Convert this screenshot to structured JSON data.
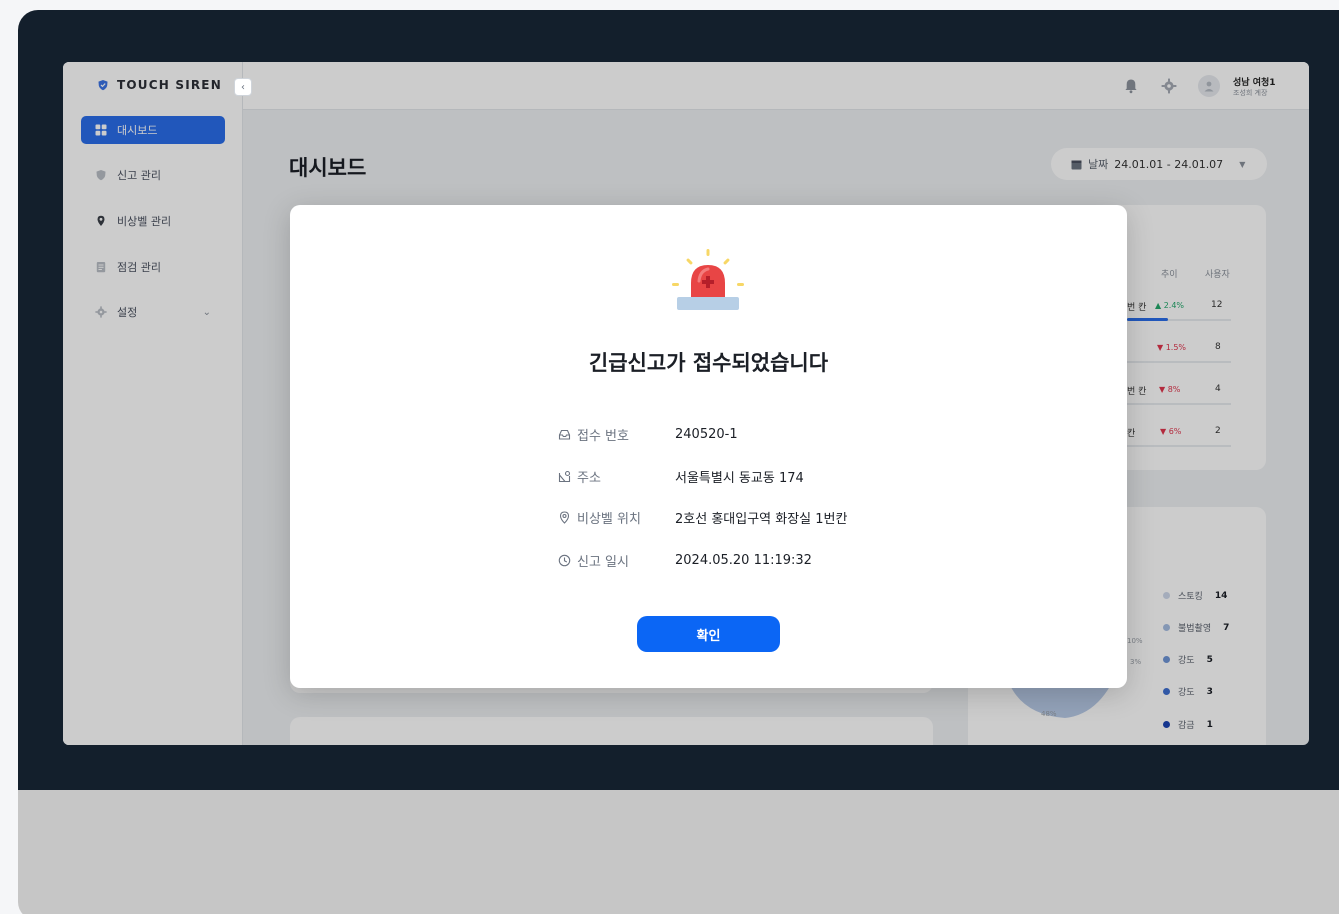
{
  "sidebar": {
    "logo_text": "TOUCH SIREN",
    "items": [
      {
        "label": "대시보드",
        "icon": "dashboard-icon",
        "active": true
      },
      {
        "label": "신고 관리",
        "icon": "shield-icon"
      },
      {
        "label": "비상벨 관리",
        "icon": "location-pin-icon"
      },
      {
        "label": "점검 관리",
        "icon": "clipboard-icon"
      },
      {
        "label": "설정",
        "icon": "gear-icon"
      }
    ]
  },
  "header": {
    "user_name": "성남 여청1",
    "user_role": "조성희 계장"
  },
  "main": {
    "page_title": "대시보드",
    "date_filter": {
      "label": "날짜",
      "value": "24.01.01 - 24.01.07"
    }
  },
  "table": {
    "headers": [
      "추이",
      "사용자"
    ],
    "rows": [
      {
        "location": "번 칸",
        "trend": "▲ 2.4%",
        "users": "12"
      },
      {
        "location": "",
        "trend": "▼ 1.5%",
        "users": "8"
      },
      {
        "location": "번 칸",
        "trend": "▼ 8%",
        "users": "4"
      },
      {
        "location": "칸",
        "trend": "▼ 6%",
        "users": "2"
      }
    ]
  },
  "pie": {
    "labels": [
      "10%",
      "3%",
      "48%"
    ],
    "legend": [
      {
        "label": "스토킹",
        "value": "14",
        "color": "#cdd8ea"
      },
      {
        "label": "불법촬영",
        "value": "7",
        "color": "#a6bde2"
      },
      {
        "label": "강도",
        "value": "5",
        "color": "#6f95d6"
      },
      {
        "label": "강도",
        "value": "3",
        "color": "#3e6fd0"
      },
      {
        "label": "감금",
        "value": "1",
        "color": "#1b44b3"
      }
    ]
  },
  "modal": {
    "title": "긴급신고가 접수되었습니다",
    "rows": [
      {
        "label": "접수 번호",
        "value": "240520-1",
        "icon": "inbox-icon"
      },
      {
        "label": "주소",
        "value": "서울특별시 동교동 174",
        "icon": "map-icon"
      },
      {
        "label": "비상벨 위치",
        "value": "2호선 홍대입구역 화장실 1번칸",
        "icon": "location-pin-icon"
      },
      {
        "label": "신고 일시",
        "value": "2024.05.20 11:19:32",
        "icon": "clock-icon"
      }
    ],
    "confirm_label": "확인"
  },
  "colors": {
    "accent": "#0b66f5",
    "sidebar_active": "#2a6dea",
    "frame": "#131f2c"
  }
}
